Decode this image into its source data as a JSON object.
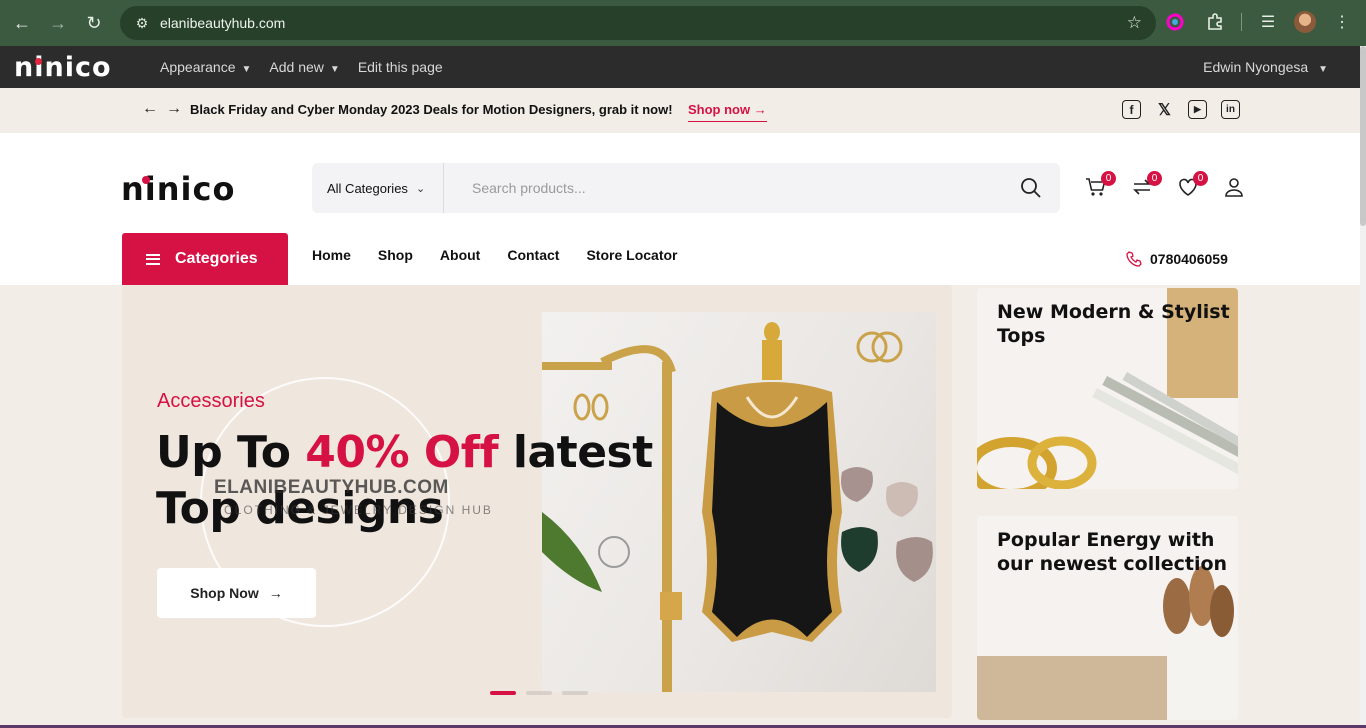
{
  "browser": {
    "url": "elanibeautyhub.com"
  },
  "admin_bar": {
    "logo": "ninico",
    "menu": [
      {
        "label": "Appearance",
        "has_caret": true
      },
      {
        "label": "Add new",
        "has_caret": true
      },
      {
        "label": "Edit this page",
        "has_caret": false
      }
    ],
    "user": "Edwin Nyongesa"
  },
  "promo_bar": {
    "message": "Black Friday and Cyber Monday 2023 Deals for Motion Designers, grab it now!",
    "link_label": "Shop now",
    "social": [
      "facebook-icon",
      "x-icon",
      "youtube-icon",
      "linkedin-icon"
    ]
  },
  "header": {
    "logo": "ninico",
    "category_select": "All Categories",
    "search_placeholder": "Search products...",
    "cart_count": "0",
    "compare_count": "0",
    "wishlist_count": "0"
  },
  "nav": {
    "categories_label": "Categories",
    "items": [
      "Home",
      "Shop",
      "About",
      "Contact",
      "Store Locator"
    ],
    "phone": "0780406059"
  },
  "hero": {
    "kicker": "Accessories",
    "title_part1": "Up To ",
    "title_accent": "40% Off",
    "title_part2": " latest",
    "title_line2": "Top designs",
    "cta": "Shop Now",
    "watermark": "ELANIBEAUTYHUB.COM",
    "watermark_sub": "CLOTHING & JEWELRY DESIGN HUB",
    "slides": 3,
    "active_slide": 1
  },
  "side_cards": [
    {
      "title": "New Modern & Stylist Tops"
    },
    {
      "title": "Popular Energy with our newest collection"
    }
  ],
  "colors": {
    "accent": "#d51243",
    "chrome": "#3b5a3f",
    "admin_bar": "#2c2c2c",
    "cream": "#f2ede7"
  }
}
